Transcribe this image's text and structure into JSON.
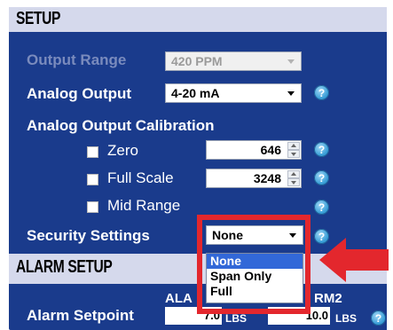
{
  "setup": {
    "title": "SETUP",
    "output_range": {
      "label": "Output Range",
      "value": "420 PPM"
    },
    "analog_output": {
      "label": "Analog Output",
      "value": "4-20 mA"
    },
    "calibration": {
      "label": "Analog Output Calibration",
      "zero": {
        "label": "Zero",
        "value": "646"
      },
      "full_scale": {
        "label": "Full Scale",
        "value": "3248"
      },
      "mid_range": {
        "label": "Mid Range"
      }
    },
    "security": {
      "label": "Security Settings",
      "value": "None",
      "options": [
        "None",
        "Span Only",
        "Full"
      ]
    },
    "help_glyph": "?"
  },
  "alarm": {
    "title": "ALARM SETUP",
    "col1_header": "ALA",
    "col2_header": "RM2",
    "setpoint_label": "Alarm Setpoint",
    "alarm1_value": "7.0",
    "alarm2_value": "10.0",
    "unit": "LBS"
  },
  "colors": {
    "panel": "#1a3b8c",
    "header": "#d5d9ec",
    "highlight": "#e3272d",
    "selected_option": "#3268d8"
  },
  "icons": [
    "help-icon",
    "dropdown-caret-icon",
    "spinner-up-icon",
    "spinner-down-icon",
    "red-arrow-icon",
    "checkbox-icon"
  ]
}
